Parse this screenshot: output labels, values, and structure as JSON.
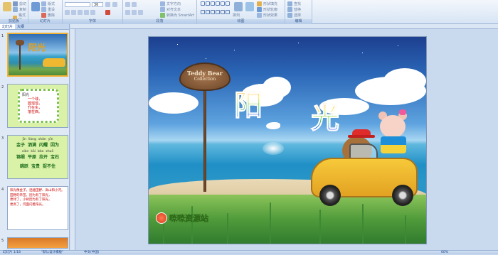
{
  "ribbon": {
    "groups": [
      {
        "label": "剪贴板"
      },
      {
        "label": "幻灯片"
      },
      {
        "label": "字体"
      },
      {
        "label": "段落"
      },
      {
        "label": "绘图"
      },
      {
        "label": "编辑"
      }
    ],
    "clipboard": {
      "paste": "粘贴",
      "cut": "剪切",
      "copy": "复制",
      "format_painter": "格式刷"
    },
    "slides": {
      "new_slide": "新建幻灯片",
      "layout": "版式",
      "reset": "重设",
      "delete": "删除"
    },
    "font": {
      "font_name": "",
      "font_size": "36"
    },
    "paragraph": {
      "text_direction": "文字方向",
      "align_text": "对齐文本",
      "smartart": "转换为 SmartArt"
    },
    "drawing": {
      "arrange": "排列",
      "quick_styles": "快速样式",
      "shape_fill": "形状填充",
      "shape_outline": "形状轮廓",
      "shape_effects": "形状效果"
    },
    "editing": {
      "find": "查找",
      "replace": "替换",
      "select": "选择"
    }
  },
  "pane": {
    "tabs": [
      "幻灯片",
      "大纲"
    ],
    "thumbnails": [
      {
        "num": "1",
        "title": "阳光"
      },
      {
        "num": "2",
        "poem_title": "阳光",
        "poem_lines": [
          "一个球，",
          "圆溜溜，",
          "升在东，",
          "落在西。"
        ]
      },
      {
        "num": "3",
        "pinyin1": [
          "jīn",
          "liàng",
          "shǎn",
          "yīn"
        ],
        "words1": [
          "金子",
          "洒满",
          "闪耀",
          "因为"
        ],
        "pinyin2": [
          "xiàn",
          "kāi",
          "bǎo",
          "zhuō"
        ],
        "words2": [
          "锦缎",
          "平原",
          "拉开",
          "宝石"
        ],
        "words3": [
          "跳跃",
          "宝贵",
          "捉不住"
        ]
      },
      {
        "num": "4",
        "lines": [
          "阳光像金子，洒遍田野、高山和小河。",
          "田野的禾苗，因为有了阳光，",
          "更绿了，小树因为有了阳光，",
          "更高了，河面闪着阳光。"
        ]
      },
      {
        "num": "5"
      }
    ]
  },
  "slide": {
    "sign_line1": "Teddy Bear",
    "sign_line2": "Collection",
    "title_char1": "阳",
    "title_char2": "光",
    "logo_text": "咪咪资源站"
  },
  "status": {
    "slide_info": "幻灯片 1/18",
    "theme": "\"默认设计模板\"",
    "language": "中文(中国)",
    "zoom": "60%"
  }
}
